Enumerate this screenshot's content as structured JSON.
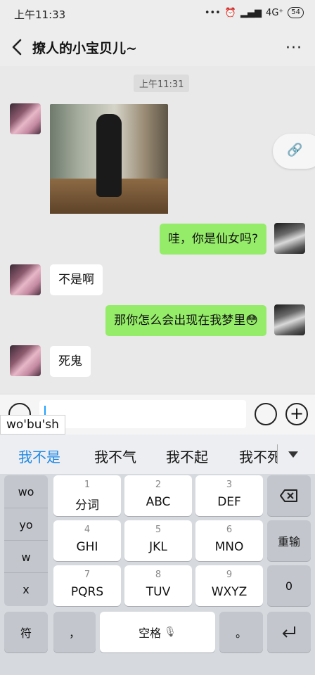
{
  "status_bar": {
    "time": "上午11:33",
    "signal_text": "4G⁺",
    "battery": "54"
  },
  "header": {
    "title": "撩人的小宝贝儿~",
    "more": "···"
  },
  "chat": {
    "timestamp": "上午11:31",
    "messages": [
      {
        "from": "other",
        "type": "image"
      },
      {
        "from": "me",
        "text": "哇，你是仙女吗?"
      },
      {
        "from": "other",
        "text": "不是啊"
      },
      {
        "from": "me",
        "text": "那你怎么会出现在我梦里😳"
      },
      {
        "from": "other",
        "text": "死鬼"
      }
    ]
  },
  "input": {
    "pinyin": "wo'bu'sh",
    "value": ""
  },
  "candidates": [
    "我不是",
    "我不气",
    "我不起",
    "我不死"
  ],
  "keyboard": {
    "left_column": [
      "wo",
      "yo",
      "w",
      "x"
    ],
    "keys": [
      {
        "num": "1",
        "label": "分词"
      },
      {
        "num": "2",
        "label": "ABC"
      },
      {
        "num": "3",
        "label": "DEF"
      },
      {
        "num": "4",
        "label": "GHI"
      },
      {
        "num": "5",
        "label": "JKL"
      },
      {
        "num": "6",
        "label": "MNO"
      },
      {
        "num": "7",
        "label": "PQRS"
      },
      {
        "num": "8",
        "label": "TUV"
      },
      {
        "num": "9",
        "label": "WXYZ"
      }
    ],
    "reenter": "重输",
    "zero": "0",
    "symbol": "符",
    "comma": "，",
    "space": "空格",
    "period": "。"
  },
  "colors": {
    "accent": "#1e88e5",
    "sent_bubble": "#95ec69",
    "received_bubble": "#ffffff"
  }
}
